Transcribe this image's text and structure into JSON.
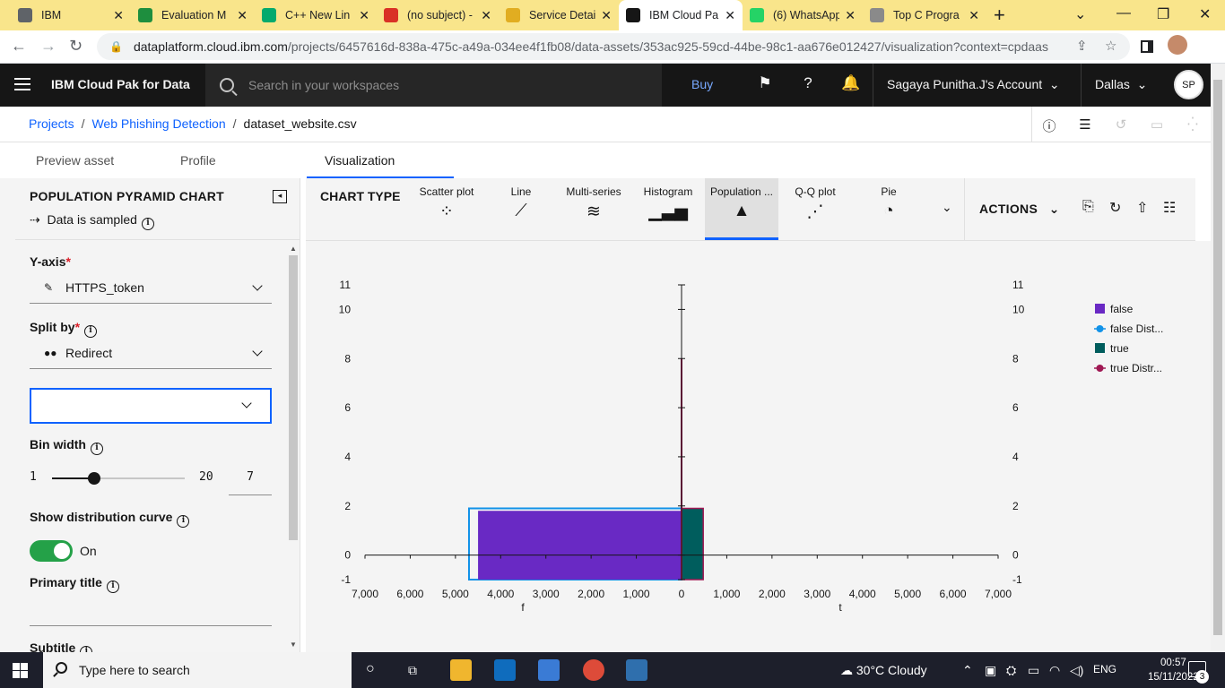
{
  "browser": {
    "tabs": [
      {
        "title": "IBM",
        "icon": "ibm-globe-icon",
        "color": "#5f6368"
      },
      {
        "title": "Evaluation M",
        "icon": "google-drive-icon",
        "color": "#1e8e3e"
      },
      {
        "title": "C++ New Lin",
        "icon": "w3schools-icon",
        "color": "#04aa6d"
      },
      {
        "title": "(no subject) -",
        "icon": "gmail-icon",
        "color": "#d93025"
      },
      {
        "title": "Service Detai",
        "icon": "cloud-icon",
        "color": "#e1ad21"
      },
      {
        "title": "IBM Cloud Pa",
        "icon": "ibm-bee-icon",
        "color": "#161616"
      },
      {
        "title": "(6) WhatsApp",
        "icon": "whatsapp-icon",
        "color": "#25d366"
      },
      {
        "title": "Top C Progra",
        "icon": "tp-icon",
        "color": "#8a8a8a"
      }
    ],
    "url_host": "dataplatform.cloud.ibm.com",
    "url_path": "/projects/6457616d-838a-475c-a49a-034ee4f1fb08/data-assets/353ac925-59cd-44be-98c1-aa676e012427/visualization?context=cpdaas"
  },
  "header": {
    "product": "IBM Cloud Pak for Data",
    "search_placeholder": "Search in your workspaces",
    "buy": "Buy",
    "account": "Sagaya Punitha.J's Account",
    "region": "Dallas",
    "avatar": "SP"
  },
  "breadcrumb": {
    "projects": "Projects",
    "project": "Web Phishing Detection",
    "asset": "dataset_website.csv"
  },
  "tabs": {
    "preview": "Preview asset",
    "profile": "Profile",
    "visualization": "Visualization"
  },
  "panel": {
    "title": "POPULATION PYRAMID CHART",
    "sampled": "Data is sampled",
    "yaxis_label": "Y-axis",
    "yaxis_value": "HTTPS_token",
    "splitby_label": "Split by",
    "splitby_value": "Redirect",
    "binwidth_label": "Bin width",
    "bin_min": "1",
    "bin_max": "20",
    "bin_value": "7",
    "bin_fraction": 0.316,
    "distcurve_label": "Show distribution curve",
    "distcurve_state": "On",
    "primary_title_label": "Primary title",
    "subtitle_label": "Subtitle"
  },
  "chart_types": {
    "label": "CHART TYPE",
    "items": [
      {
        "name": "Scatter plot",
        "glyph": "⁘"
      },
      {
        "name": "Line",
        "glyph": "⟋"
      },
      {
        "name": "Multi-series",
        "glyph": "≋"
      },
      {
        "name": "Histogram",
        "glyph": "▁▃▅"
      },
      {
        "name": "Population ...",
        "glyph": "▲"
      },
      {
        "name": "Q-Q plot",
        "glyph": "⋰"
      },
      {
        "name": "Pie",
        "glyph": "◔"
      }
    ],
    "actions": "ACTIONS"
  },
  "chart_data": {
    "type": "bar",
    "orientation": "population-pyramid",
    "y_ticks_left": [
      "11",
      "10",
      "8",
      "6",
      "4",
      "2",
      "0",
      "-1"
    ],
    "y_ticks_right": [
      "11",
      "10",
      "8",
      "6",
      "4",
      "2",
      "0",
      "-1"
    ],
    "ylim": [
      -1,
      11
    ],
    "x_ticks": [
      "7,000",
      "6,000",
      "5,000",
      "4,000",
      "3,000",
      "2,000",
      "1,000",
      "0",
      "1,000",
      "2,000",
      "3,000",
      "4,000",
      "5,000",
      "6,000",
      "7,000"
    ],
    "xlim": [
      -7000,
      7000
    ],
    "left_axis_label": "f",
    "right_axis_label": "t",
    "series": [
      {
        "name": "false",
        "side": "left",
        "color": "#6929c4",
        "bin": [
          -1,
          1.8
        ],
        "count": 4500
      },
      {
        "name": "false Dist...",
        "side": "left",
        "color": "#1192e8",
        "bin": [
          -1,
          1.9
        ],
        "count": 4700
      },
      {
        "name": "true",
        "side": "right",
        "color": "#005d5d",
        "bin": [
          -1,
          1.9
        ],
        "count": 480
      },
      {
        "name": "true Distr...",
        "side": "right",
        "color": "#9f1853",
        "bin": [
          -1,
          8
        ],
        "count": 0
      }
    ]
  },
  "taskbar": {
    "search_placeholder": "Type here to search",
    "weather": "30°C  Cloudy",
    "lang": "ENG",
    "time": "00:57",
    "date": "15/11/2022",
    "notifications": "3"
  }
}
